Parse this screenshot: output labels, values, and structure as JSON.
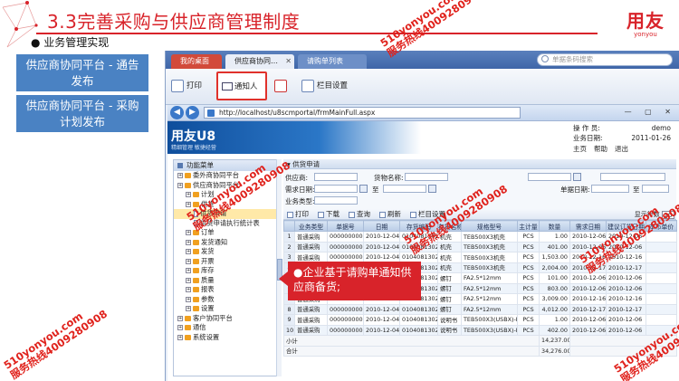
{
  "slide": {
    "title": "3.3完善采购与供应商管理制度",
    "bullet": "业务管理实现",
    "logo_text": "用友",
    "logo_sub": "yonyou"
  },
  "left_boxes": [
    "供应商协同平台 - 通告发布",
    "供应商协同平台 - 采购计划发布"
  ],
  "app": {
    "tabs": [
      "我的桌面",
      "供应商协同…",
      "请购单列表"
    ],
    "search_placeholder": "单据条码搜索",
    "toolbar": {
      "print": "打印",
      "notify": "通知人",
      "columns": "栏目设置"
    }
  },
  "browser": {
    "back": "◀",
    "forward": "▶",
    "url": "http://localhost/u8scmportal/frmMainFull.aspx",
    "window_controls": "— ▢ ✕"
  },
  "portal": {
    "logo": "用友U8",
    "slogan": "精细管理 敏捷经营",
    "operator_label": "操 作 员:",
    "operator": "demo",
    "date_label": "业务日期:",
    "date": "2011-01-26",
    "links": [
      "主页",
      "帮助",
      "退出"
    ]
  },
  "menu": {
    "header": "功能菜单",
    "items": [
      {
        "label": "委外商协同平台",
        "level": 0,
        "type": "folder"
      },
      {
        "label": "供应商协同平台",
        "level": 0,
        "type": "folder"
      },
      {
        "label": "计划",
        "level": 1,
        "type": "folder"
      },
      {
        "label": "供货",
        "level": 1,
        "type": "folder"
      },
      {
        "label": "供货申请",
        "level": 2,
        "type": "doc",
        "selected": true
      },
      {
        "label": "供货申请执行统计表",
        "level": 2,
        "type": "doc"
      },
      {
        "label": "订单",
        "level": 1,
        "type": "folder"
      },
      {
        "label": "发货通知",
        "level": 1,
        "type": "folder"
      },
      {
        "label": "发货",
        "level": 1,
        "type": "folder"
      },
      {
        "label": "开票",
        "level": 1,
        "type": "folder"
      },
      {
        "label": "库存",
        "level": 1,
        "type": "folder"
      },
      {
        "label": "质量",
        "level": 1,
        "type": "folder"
      },
      {
        "label": "报表",
        "level": 1,
        "type": "folder"
      },
      {
        "label": "参数",
        "level": 1,
        "type": "folder"
      },
      {
        "label": "设置",
        "level": 1,
        "type": "folder"
      },
      {
        "label": "客户协同平台",
        "level": 0,
        "type": "folder"
      },
      {
        "label": "通信",
        "level": 0,
        "type": "folder"
      },
      {
        "label": "系统设置",
        "level": 0,
        "type": "folder"
      }
    ]
  },
  "content": {
    "section": "供货申请",
    "filters": {
      "supplier": "供应商:",
      "need_date": "需求日期:",
      "supply_type": "业务类型:",
      "to": "至",
      "goods": "货物名称:",
      "doc_date": "单据日期:"
    },
    "grid_tools": [
      "打印",
      "下载",
      "查询",
      "刷新",
      "栏目设置"
    ],
    "display_count_label": "显示行数",
    "display_count": "10",
    "columns": [
      "",
      "业务类型",
      "单据号",
      "日期",
      "存货编码",
      "存货名称",
      "规格型号",
      "主计量",
      "数量",
      "需求日期",
      "建议订货日期",
      "本币单价"
    ],
    "rows": [
      [
        "1",
        "普通采购",
        "0000000002",
        "2010-12-04",
        "01040813026",
        "机壳",
        "TEB500X3机壳",
        "PCS",
        "1.00",
        "2010-12-06",
        "2010-12-06",
        ""
      ],
      [
        "2",
        "普通采购",
        "0000000002",
        "2010-12-04",
        "01040813026",
        "机壳",
        "TEB500X3机壳",
        "PCS",
        "401.00",
        "2010-12-06",
        "2010-12-06",
        ""
      ],
      [
        "3",
        "普通采购",
        "0000000002",
        "2010-12-04",
        "01040813026",
        "机壳",
        "TEB500X3机壳",
        "PCS",
        "1,503.00",
        "2010-12-16",
        "2010-12-16",
        ""
      ],
      [
        "4",
        "普通采购",
        "0000000002",
        "2010-12-04",
        "01040813026",
        "机壳",
        "TEB500X3机壳",
        "PCS",
        "2,004.00",
        "2010-12-17",
        "2010-12-17",
        ""
      ],
      [
        "5",
        "普通采购",
        "0000000002",
        "2010-12-04",
        "01040813027",
        "螺钉",
        "FA2.5*12mm",
        "PCS",
        "101.00",
        "2010-12-06",
        "2010-12-06",
        ""
      ],
      [
        "6",
        "普通采购",
        "0000000002",
        "2010-12-04",
        "01040813027",
        "螺钉",
        "FA2.5*12mm",
        "PCS",
        "803.00",
        "2010-12-06",
        "2010-12-06",
        ""
      ],
      [
        "7",
        "普通采购",
        "0000000002",
        "2010-12-04",
        "01040813027",
        "螺钉",
        "FA2.5*12mm",
        "PCS",
        "3,009.00",
        "2010-12-16",
        "2010-12-16",
        ""
      ],
      [
        "8",
        "普通采购",
        "0000000002",
        "2010-12-04",
        "01040813027",
        "螺钉",
        "FA2.5*12mm",
        "PCS",
        "4,012.00",
        "2010-12-17",
        "2010-12-17",
        ""
      ],
      [
        "9",
        "普通采购",
        "0000000002",
        "2010-12-04",
        "01040813028",
        "说明书",
        "TEB500X3(USBX)-INT01",
        "PCS",
        "1.00",
        "2010-12-06",
        "2010-12-06",
        ""
      ],
      [
        "10",
        "普通采购",
        "0000000002",
        "2010-12-04",
        "01040813028",
        "说明书",
        "TEB500X3(USBX)-INT01",
        "PCS",
        "402.00",
        "2010-12-06",
        "2010-12-06",
        ""
      ]
    ],
    "subtotal_label": "小计",
    "subtotal": "14,237.00",
    "total_label": "合计",
    "total": "34,276.00"
  },
  "callout": "企业基于请购单通知供应商备货;",
  "watermark": {
    "line1": "510yonyou.com",
    "line2": "服务热线4009280908"
  },
  "colors": {
    "brand_red": "#d8232a",
    "nav_blue": "#4a82c3",
    "tab_active_red": "#d24a3a"
  }
}
